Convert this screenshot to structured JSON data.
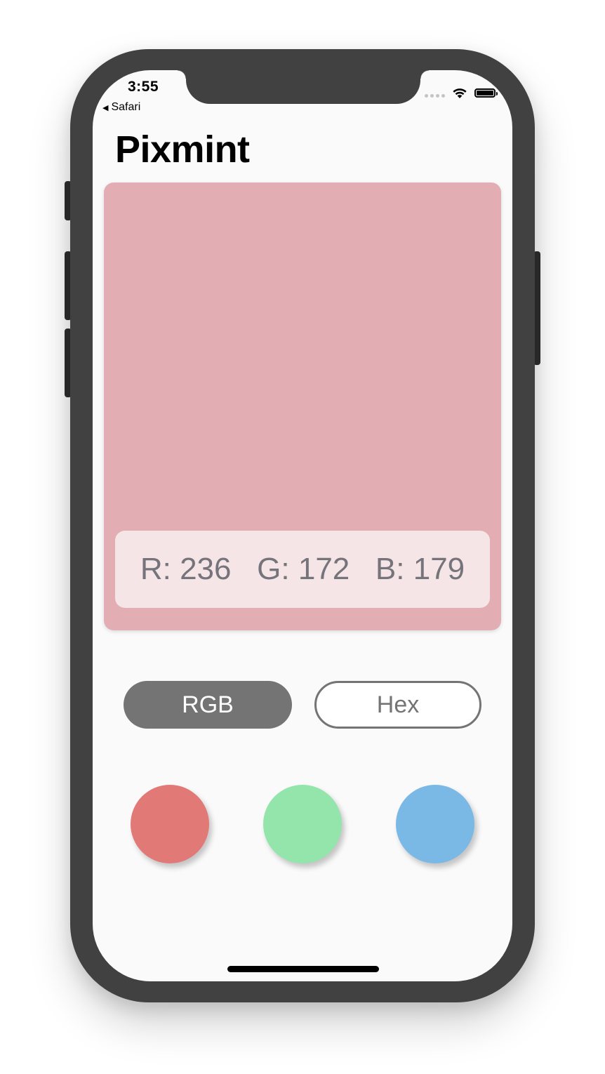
{
  "status_bar": {
    "time": "3:55",
    "back_label": "Safari",
    "back_icon": "back-triangle-icon"
  },
  "app": {
    "title": "Pixmint"
  },
  "swatch": {
    "color": "#e2aeb3",
    "readout": "R: 236   G: 172   B: 179"
  },
  "mode": {
    "rgb_label": "RGB",
    "hex_label": "Hex",
    "selected": "RGB"
  },
  "color_dots": [
    {
      "name": "red",
      "color": "#e17a77"
    },
    {
      "name": "green",
      "color": "#93e5ab"
    },
    {
      "name": "blue",
      "color": "#7ab8e5"
    }
  ],
  "colors": {
    "phone_frame": "#414141",
    "screen_bg": "#fafafa",
    "button_active": "#747474"
  }
}
